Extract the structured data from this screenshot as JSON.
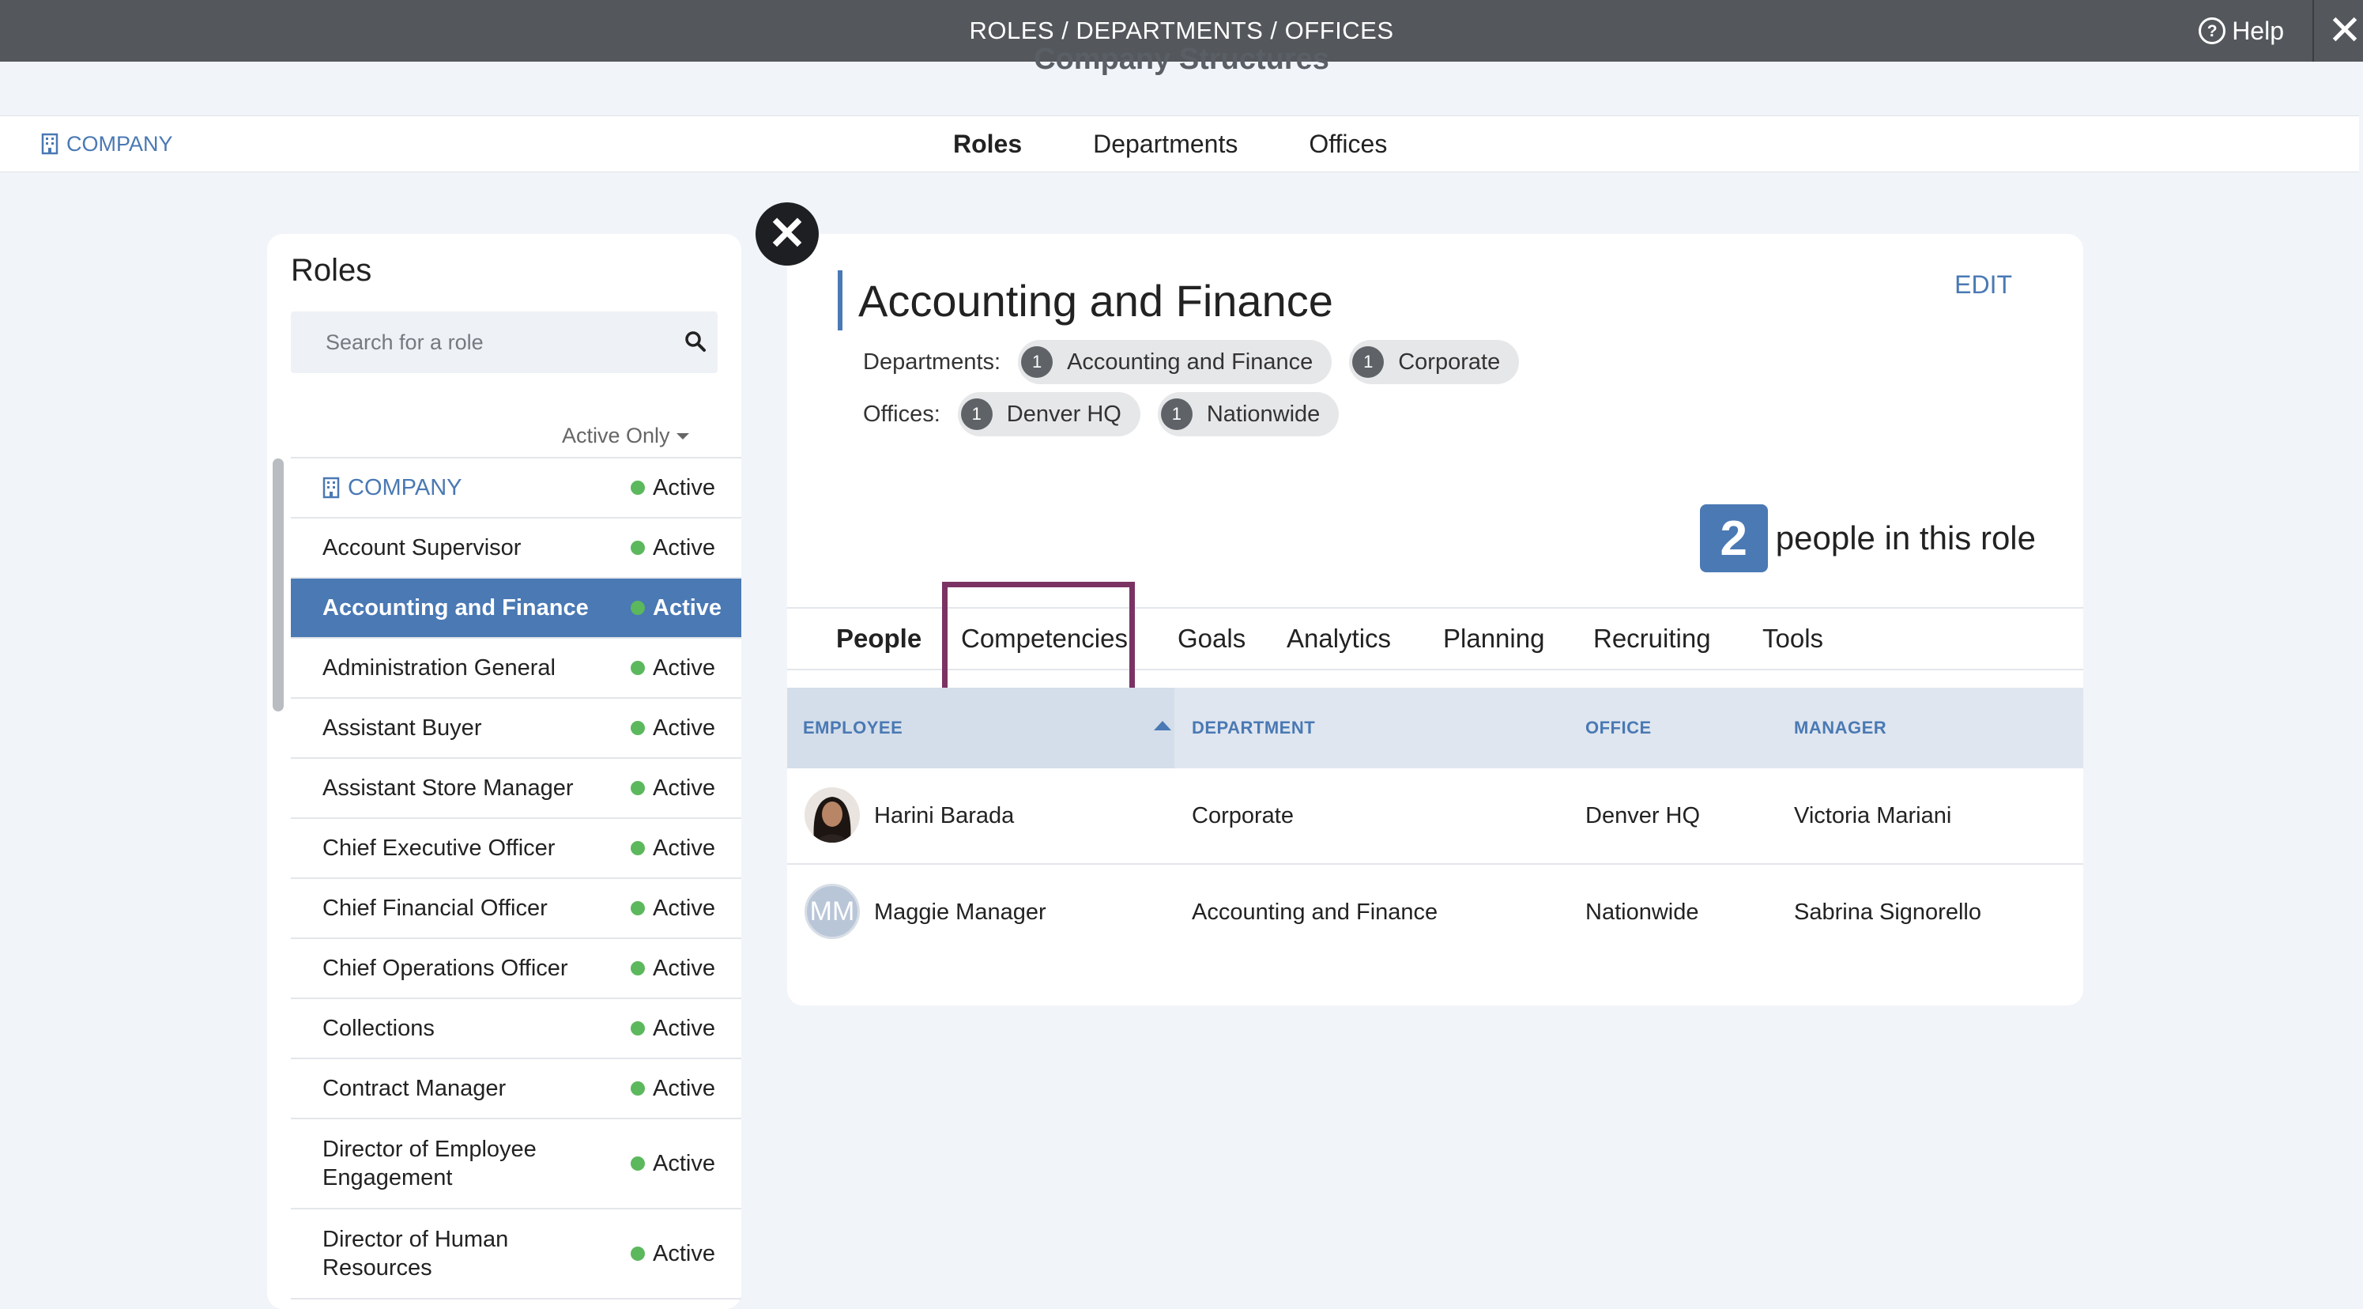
{
  "topbar": {
    "title": "ROLES / DEPARTMENTS / OFFICES",
    "help_label": "Help",
    "help_icon": "question-circle-icon",
    "close_icon": "close-icon"
  },
  "page": {
    "heading": "Company Structures"
  },
  "subnav": {
    "company_label": "COMPANY",
    "tabs": [
      "Roles",
      "Departments",
      "Offices"
    ],
    "active_tab": "Roles"
  },
  "roles_panel": {
    "title": "Roles",
    "search_placeholder": "Search for a role",
    "filter_label": "Active Only",
    "items": [
      {
        "name": "COMPANY",
        "status": "Active",
        "is_company": true
      },
      {
        "name": "Account Supervisor",
        "status": "Active"
      },
      {
        "name": "Accounting and Finance",
        "status": "Active",
        "selected": true
      },
      {
        "name": "Administration General",
        "status": "Active"
      },
      {
        "name": "Assistant Buyer",
        "status": "Active"
      },
      {
        "name": "Assistant Store Manager",
        "status": "Active"
      },
      {
        "name": "Chief Executive Officer",
        "status": "Active"
      },
      {
        "name": "Chief Financial Officer",
        "status": "Active"
      },
      {
        "name": "Chief Operations Officer",
        "status": "Active"
      },
      {
        "name": "Collections",
        "status": "Active"
      },
      {
        "name": "Contract Manager",
        "status": "Active"
      },
      {
        "name": "Director of Employee Engagement",
        "status": "Active"
      },
      {
        "name": "Director of Human Resources",
        "status": "Active"
      }
    ]
  },
  "detail": {
    "title": "Accounting and Finance",
    "edit_label": "EDIT",
    "departments_label": "Departments:",
    "departments": [
      {
        "count": "1",
        "name": "Accounting and Finance"
      },
      {
        "count": "1",
        "name": "Corporate"
      }
    ],
    "offices_label": "Offices:",
    "offices": [
      {
        "count": "1",
        "name": "Denver HQ"
      },
      {
        "count": "1",
        "name": "Nationwide"
      }
    ],
    "people_count": "2",
    "people_count_label": "people in this role",
    "tabs": [
      "People",
      "Competencies",
      "Goals",
      "Analytics",
      "Planning",
      "Recruiting",
      "Tools"
    ],
    "active_tab": "People",
    "highlighted_tab": "Competencies",
    "table": {
      "columns": [
        "EMPLOYEE",
        "DEPARTMENT",
        "OFFICE",
        "MANAGER"
      ],
      "sorted_column": "EMPLOYEE",
      "sort_direction": "ascending",
      "rows": [
        {
          "employee": "Harini Barada",
          "avatar": "photo",
          "department": "Corporate",
          "office": "Denver HQ",
          "manager": "Victoria Mariani"
        },
        {
          "employee": "Maggie Manager",
          "avatar": "MM",
          "department": "Accounting and Finance",
          "office": "Nationwide",
          "manager": "Sabrina Signorello"
        }
      ]
    }
  },
  "colors": {
    "topbar": "#54585c",
    "accent": "#4a79b4",
    "active_dot": "#5cb85c",
    "highlight": "#7b3364"
  }
}
